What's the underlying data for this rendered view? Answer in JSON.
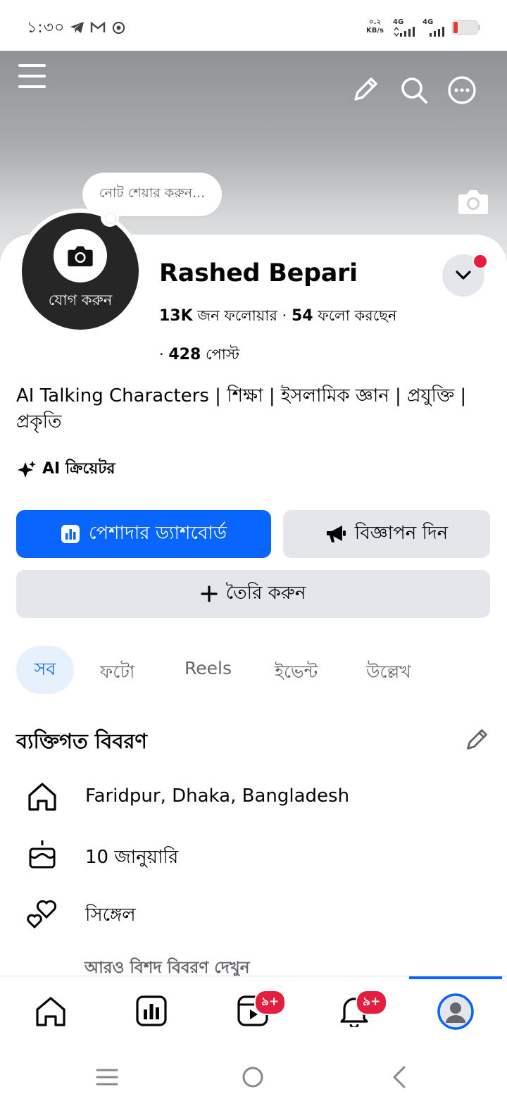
{
  "status_bar": {
    "time": "১:৩০",
    "net_speed_value": "০.২",
    "net_speed_unit": "KB/s",
    "signal1_label": "4G",
    "signal2_label": "4G",
    "battery_color": "#e53935"
  },
  "cover": {
    "note_placeholder": "নোট শেয়ার করুন..."
  },
  "profile": {
    "avatar_label": "যোগ করুন",
    "name": "Rashed Bepari",
    "followers_count": "13K",
    "followers_label": "জন ফলোয়ার",
    "following_count": "54",
    "following_label": "ফলো করছেন",
    "posts_count": "428",
    "posts_label": "পোস্ট",
    "bio": "AI Talking Characters | শিক্ষা | ইসলামিক জ্ঞান | প্রযুক্তি | প্রকৃতি",
    "creator_label": "AI ক্রিয়েটর"
  },
  "actions": {
    "dashboard_label": "পেশাদার ড্যাশবোর্ড",
    "ads_label": "বিজ্ঞাপন দিন",
    "create_label": "তৈরি করুন"
  },
  "tabs": [
    "সব",
    "ফটো",
    "Reels",
    "ইভেন্ট",
    "উল্লেখ"
  ],
  "details": {
    "heading": "ব্যক্তিগত বিবরণ",
    "location": "Faridpur, Dhaka, Bangladesh",
    "birthday": "10 জানুয়ারি",
    "relationship": "সিঙ্গেল",
    "see_more": "আরও বিশদ বিবরণ দেখুন"
  },
  "bottom_nav": {
    "reels_badge": "৯+",
    "notifications_badge": "৯+",
    "accent_color": "#0866ff"
  }
}
